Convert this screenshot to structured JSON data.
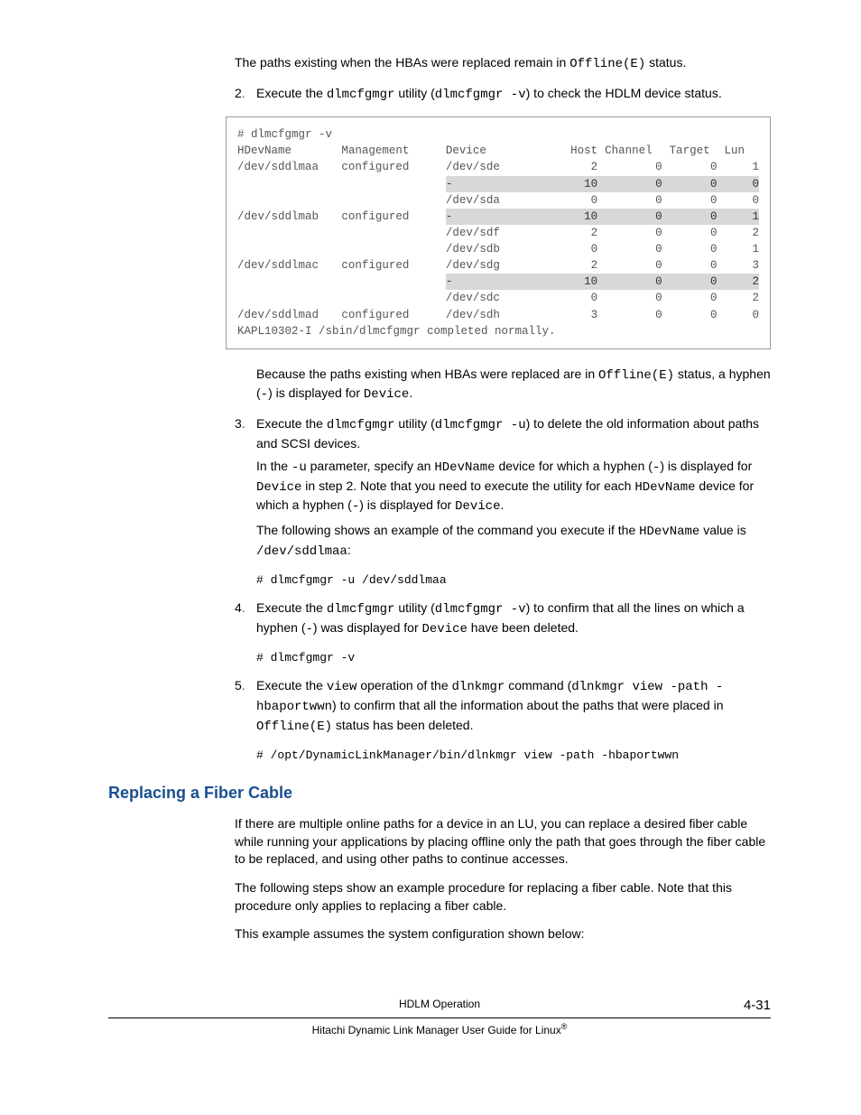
{
  "intro": {
    "p1a": "The paths existing when the HBAs were replaced remain in ",
    "p1b": "Offline(E)",
    "p1c": " status."
  },
  "step2": {
    "num": "2",
    "a": "Execute the ",
    "b": "dlmcfgmgr",
    "c": " utility (",
    "d": "dlmcfgmgr -v",
    "e": ") to check the HDLM device status."
  },
  "table": {
    "cmd": "# dlmcfgmgr -v",
    "h1": "HDevName",
    "h2": "Management",
    "h3": "Device",
    "h4": "Host",
    "h5": "Channel",
    "h6": "Target",
    "h7": "Lun",
    "r": [
      {
        "c1": "/dev/sddlmaa",
        "c2": "configured",
        "c3": "/dev/sde",
        "c4": "2",
        "c5": "0",
        "c6": "0",
        "c7": "1",
        "hl": false
      },
      {
        "c1": "",
        "c2": "",
        "c3": "-",
        "c4": "10",
        "c5": "0",
        "c6": "0",
        "c7": "0",
        "hl": true
      },
      {
        "c1": "",
        "c2": "",
        "c3": "/dev/sda",
        "c4": "0",
        "c5": "0",
        "c6": "0",
        "c7": "0",
        "hl": false
      },
      {
        "c1": "/dev/sddlmab",
        "c2": "configured",
        "c3": "-",
        "c4": "10",
        "c5": "0",
        "c6": "0",
        "c7": "1",
        "hl": true
      },
      {
        "c1": "",
        "c2": "",
        "c3": "/dev/sdf",
        "c4": "2",
        "c5": "0",
        "c6": "0",
        "c7": "2",
        "hl": false
      },
      {
        "c1": "",
        "c2": "",
        "c3": "/dev/sdb",
        "c4": "0",
        "c5": "0",
        "c6": "0",
        "c7": "1",
        "hl": false
      },
      {
        "c1": "/dev/sddlmac",
        "c2": "configured",
        "c3": "/dev/sdg",
        "c4": "2",
        "c5": "0",
        "c6": "0",
        "c7": "3",
        "hl": false
      },
      {
        "c1": "",
        "c2": "",
        "c3": "-",
        "c4": "10",
        "c5": "0",
        "c6": "0",
        "c7": "2",
        "hl": true
      },
      {
        "c1": "",
        "c2": "",
        "c3": "/dev/sdc",
        "c4": "0",
        "c5": "0",
        "c6": "0",
        "c7": "2",
        "hl": false
      },
      {
        "c1": "/dev/sddlmad",
        "c2": "configured",
        "c3": "/dev/sdh",
        "c4": "3",
        "c5": "0",
        "c6": "0",
        "c7": "0",
        "hl": false
      }
    ],
    "footer": "KAPL10302-I /sbin/dlmcfgmgr completed normally."
  },
  "after_table": {
    "a": "Because the paths existing when HBAs were replaced are in ",
    "b": "Offline(E)",
    "c": " status, a hyphen (",
    "d": "-",
    "e": ") is displayed for ",
    "f": "Device",
    "g": "."
  },
  "step3": {
    "num": "3",
    "l1a": "Execute the ",
    "l1b": "dlmcfgmgr",
    "l1c": " utility (",
    "l1d": "dlmcfgmgr -u",
    "l1e": ") to delete the old information about paths and SCSI devices.",
    "l2a": "In the ",
    "l2b": "-u",
    "l2c": " parameter, specify an ",
    "l2d": "HDevName",
    "l2e": " device for which a hyphen (",
    "l2f": "-",
    "l2g": ") is displayed for ",
    "l2h": "Device",
    "l2i": " in step 2. Note that you need to execute the utility for each ",
    "l2j": "HDevName",
    "l2k": " device for which a hyphen (",
    "l2l": "-",
    "l2m": ") is displayed for ",
    "l2n": "Device",
    "l2o": ".",
    "l3a": "The following shows an example of the command you execute if the ",
    "l3b": "HDevName",
    "l3c": " value is ",
    "l3d": "/dev/sddlmaa",
    "l3e": ":",
    "code": "# dlmcfgmgr -u /dev/sddlmaa"
  },
  "step4": {
    "num": "4",
    "a": "Execute the ",
    "b": "dlmcfgmgr",
    "c": " utility (",
    "d": "dlmcfgmgr -v",
    "e": ") to confirm that all the lines on which a hyphen (",
    "f": "-",
    "g": ") was displayed for ",
    "h": "Device",
    "i": " have been deleted.",
    "code": "# dlmcfgmgr -v"
  },
  "step5": {
    "num": "5",
    "a": "Execute the ",
    "b": "view",
    "c": " operation of the ",
    "d": "dlnkmgr",
    "e": " command (",
    "f": "dlnkmgr view -path -hbaportwwn",
    "g": ") to confirm that all the information about the paths that were placed in ",
    "h": "Offline(E)",
    "i": " status has been deleted.",
    "code": "# /opt/DynamicLinkManager/bin/dlnkmgr view -path -hbaportwwn"
  },
  "heading": "Replacing a Fiber Cable",
  "sec": {
    "p1": "If there are multiple online paths for a device in an LU, you can replace a desired fiber cable while running your applications by placing offline only the path that goes through the fiber cable to be replaced, and using other paths to continue accesses.",
    "p2": "The following steps show an example procedure for replacing a fiber cable. Note that this procedure only applies to replacing a fiber cable.",
    "p3": "This example assumes the system configuration shown below:"
  },
  "footer": {
    "top": "HDLM Operation",
    "page": "4-31",
    "bottom": "Hitachi Dynamic Link Manager User Guide for Linux"
  }
}
